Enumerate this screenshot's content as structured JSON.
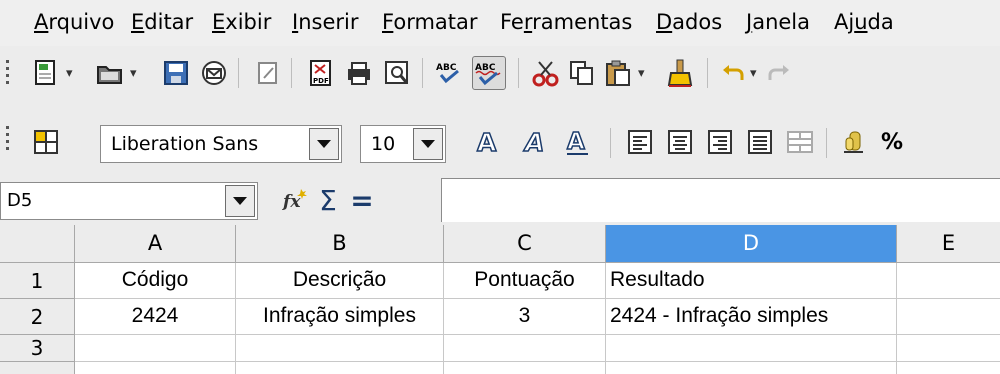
{
  "menu": [
    {
      "label": "Arquivo"
    },
    {
      "label": "Editar"
    },
    {
      "label": "Exibir"
    },
    {
      "label": "Inserir"
    },
    {
      "label": "Formatar"
    },
    {
      "label": "Ferramentas"
    },
    {
      "label": "Dados"
    },
    {
      "label": "Janela"
    },
    {
      "label": "Ajuda"
    }
  ],
  "toolbar_standard": {
    "icons": [
      "new-document-icon",
      "open-folder-icon",
      "save-icon",
      "email-icon",
      "edit-file-icon",
      "export-pdf-icon",
      "print-icon",
      "print-preview-icon",
      "spellcheck-icon",
      "autospellcheck-icon",
      "cut-icon",
      "copy-icon",
      "paste-icon",
      "clone-formatting-icon",
      "undo-icon",
      "redo-icon"
    ]
  },
  "toolbar_formatting": {
    "font_name": "Liberation Sans",
    "font_size": "10",
    "percent_label": "%"
  },
  "formula_bar": {
    "name_box": "D5",
    "sum_symbol": "Σ",
    "equals_symbol": "="
  },
  "sheet": {
    "columns": [
      "A",
      "B",
      "C",
      "D",
      "E"
    ],
    "selected_column": "D",
    "row_numbers": [
      "1",
      "2",
      "3"
    ],
    "rows": [
      [
        "Código",
        "Descrição",
        "Pontuação",
        "Resultado",
        ""
      ],
      [
        "2424",
        "Infração simples",
        "3",
        "2424 - Infração simples",
        ""
      ],
      [
        "",
        "",
        "",
        "",
        ""
      ]
    ]
  },
  "colors": {
    "selected_header": "#4a95e4",
    "toolbar_bg": "#ececec"
  }
}
